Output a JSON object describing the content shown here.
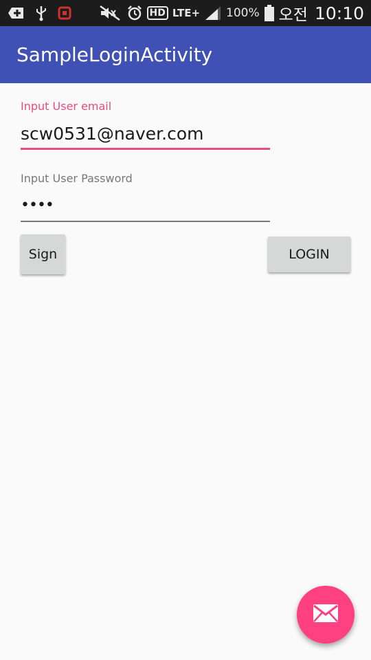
{
  "status_bar": {
    "icons": [
      "add-icon",
      "usb-icon",
      "notification-app-icon",
      "mute-icon",
      "alarm-icon",
      "hd-icon",
      "lte-icon",
      "signal-icon",
      "battery-icon"
    ],
    "hd_label": "HD",
    "lte_label": "LTE+",
    "battery_percent": "100%",
    "ampm": "오전",
    "time": "10:10"
  },
  "app_bar": {
    "title": "SampleLoginActivity",
    "color": "#3f51b5"
  },
  "form": {
    "email_label": "Input User email",
    "email_value": "scw0531@naver.com",
    "password_label": "Input User Password",
    "password_value": "••••"
  },
  "buttons": {
    "sign_label": "Sign",
    "login_label": "LOGIN"
  },
  "fab": {
    "icon": "mail-icon",
    "color": "#ff4081"
  },
  "colors": {
    "accent": "#e84c7d",
    "background": "#fafafa"
  }
}
